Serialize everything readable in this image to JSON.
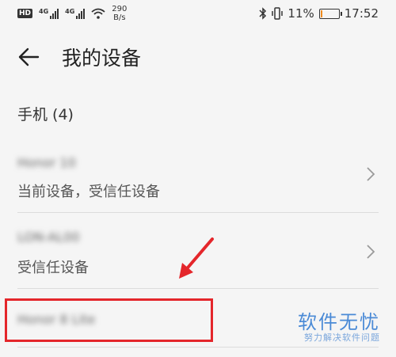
{
  "status_bar": {
    "hd_label": "HD",
    "network_1": "4G",
    "network_2": "4G",
    "speed_value": "290",
    "speed_unit": "B/s",
    "battery_percent": "11%",
    "battery_level": 0.11,
    "time": "17:52",
    "icons": [
      "hd-icon",
      "signal-icon",
      "wifi-icon",
      "bluetooth-icon",
      "vibrate-icon",
      "battery-icon"
    ]
  },
  "header": {
    "title": "我的设备",
    "back_icon": "back-arrow-icon"
  },
  "section": {
    "title": "手机 (4)"
  },
  "devices": [
    {
      "name": "Honor 10",
      "status": "当前设备，受信任设备"
    },
    {
      "name": "LON-AL00",
      "status": "受信任设备"
    },
    {
      "name": "Honor 8 Lite",
      "status": ""
    }
  ],
  "watermark": {
    "brand": "软件无忧",
    "slogan": "努力解决软件问题"
  },
  "colors": {
    "highlight": "#e4262b",
    "battery": "#f08c1e",
    "watermark": "#4a8ad6"
  }
}
